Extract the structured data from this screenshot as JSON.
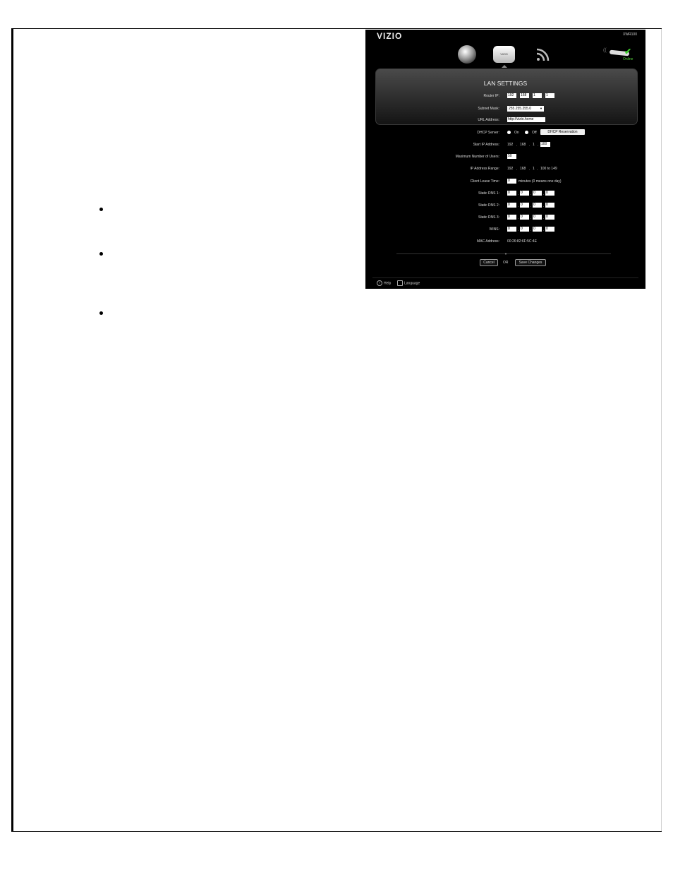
{
  "router_ui": {
    "brand": "VIZIO",
    "model": "XWR100",
    "router_icon_label": "VIZIO",
    "status": "Online",
    "panel_title": "LAN SETTINGS",
    "router_ip": {
      "label": "Router IP:",
      "octets": [
        "192",
        "168",
        "1",
        "1"
      ]
    },
    "subnet_mask": {
      "label": "Subnet Mask:",
      "value": "255.255.255.0"
    },
    "url_address": {
      "label": "URL Address:",
      "value": "http://vizio.home"
    },
    "dhcp_server": {
      "label": "DHCP Server:",
      "on": "On",
      "off": "Off",
      "reservation_button": "DHCP Reservation"
    },
    "start_ip": {
      "label": "Start IP Address:",
      "prefix": [
        "192",
        "168",
        "1"
      ],
      "last_octet": "100"
    },
    "max_users": {
      "label": "Maximum Number of Users:",
      "value": "50"
    },
    "ip_range": {
      "label": "IP Address Range:",
      "parts": [
        "192",
        "168",
        "1",
        "100 to 149"
      ]
    },
    "lease_time": {
      "label": "Client Lease Time:",
      "value": "0",
      "suffix": "minutes (0 means one day)"
    },
    "dns1": {
      "label": "Static DNS 1:",
      "octets": [
        "0",
        "0",
        "0",
        "0"
      ]
    },
    "dns2": {
      "label": "Static DNS 2:",
      "octets": [
        "0",
        "0",
        "0",
        "0"
      ]
    },
    "dns3": {
      "label": "Static DNS 3:",
      "octets": [
        "0",
        "0",
        "0",
        "0"
      ]
    },
    "wins": {
      "label": "WINS:",
      "octets": [
        "0",
        "0",
        "0",
        "0"
      ]
    },
    "mac_address": {
      "label": "MAC Address:",
      "value": "00:26:82:6F:5C:4E"
    },
    "cancel_button": "Cancel",
    "or_text": "OR",
    "save_button": "Save Changes",
    "help": "Help",
    "language": "Language",
    "help_icon_glyph": "?"
  }
}
